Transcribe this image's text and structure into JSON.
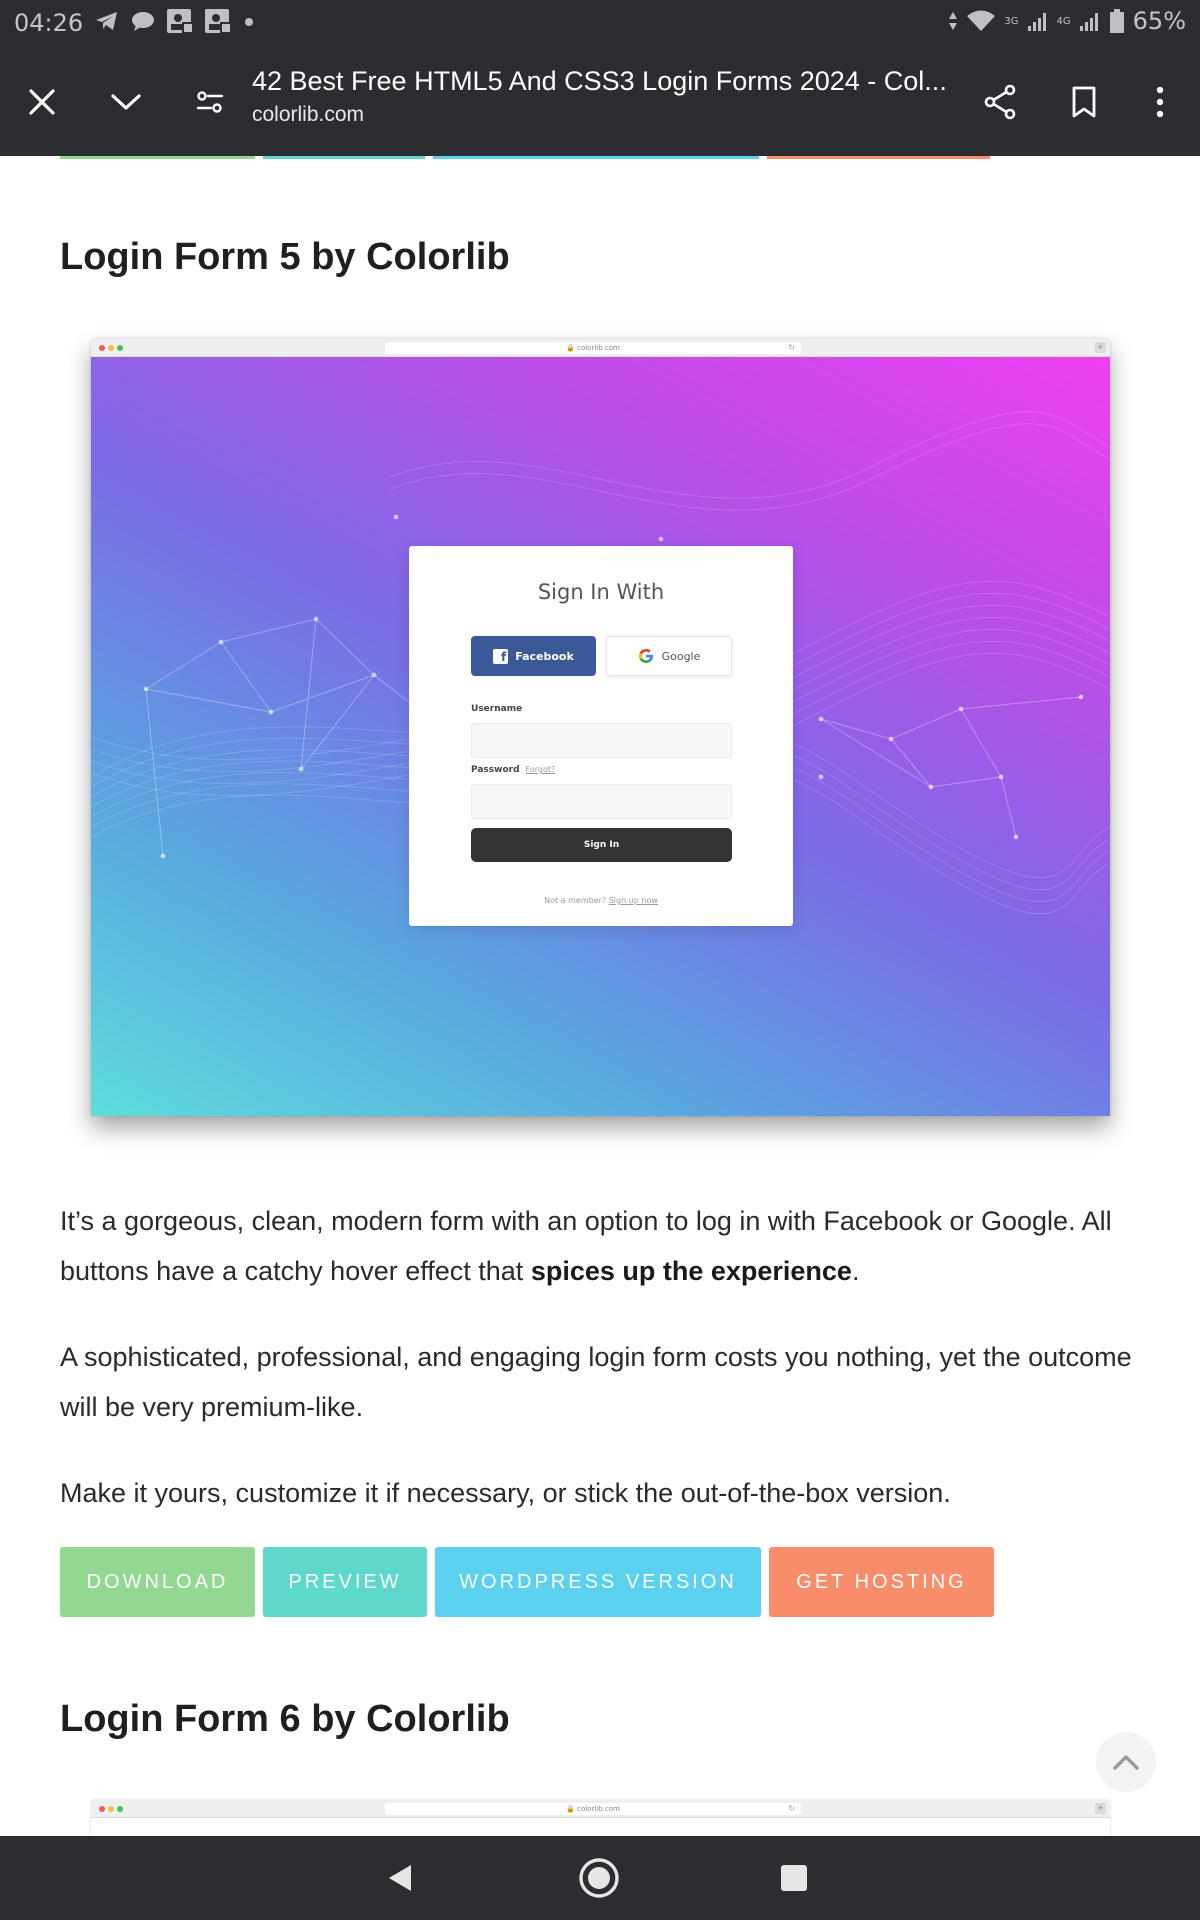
{
  "status_bar": {
    "time": "04:26",
    "left_icons": [
      "telegram-icon",
      "chat-bubble-icon",
      "photo-notification-icon",
      "photo-notification-icon",
      "dot-icon"
    ],
    "network_3g": "3G",
    "network_4g": "4G",
    "battery": "65%"
  },
  "toolbar": {
    "title": "42 Best Free HTML5 And CSS3 Login Forms 2024 - Col...",
    "url": "colorlib.com",
    "icons": [
      "close-icon",
      "chevron-down-icon",
      "page-settings-icon",
      "share-icon",
      "bookmark-icon",
      "more-vert-icon"
    ]
  },
  "article": {
    "section1_title": "Login Form 5 by Colorlib",
    "preview": {
      "address": "🔒 colorlib.com",
      "card_title": "Sign In With",
      "facebook_label": "Facebook",
      "google_label": "Google",
      "username_label": "Username",
      "password_label": "Password",
      "forgot_label": "Forgot?",
      "signin_label": "Sign In",
      "footer_text": "Not a member?",
      "footer_link": "Sign up now"
    },
    "para1_text": "It’s a gorgeous, clean, modern form with an option to log in with Facebook or Google. All buttons have a catchy hover effect that ",
    "para1_bold": "spices up the experience",
    "para1_end": ".",
    "para2": "A sophisticated, professional, and engaging login form costs you nothing, yet the outcome will be very premium-like.",
    "para3": "Make it yours, customize it if necessary, or stick the out-of-the-box version.",
    "buttons": [
      {
        "label": "DOWNLOAD",
        "color": "#93d891"
      },
      {
        "label": "PREVIEW",
        "color": "#5fd8cc"
      },
      {
        "label": "WORDPRESS VERSION",
        "color": "#5cd0ef"
      },
      {
        "label": "GET HOSTING",
        "color": "#f98c6b"
      }
    ],
    "section2_title": "Login Form 6 by Colorlib",
    "preview2_address": "🔒 colorlib.com"
  },
  "colors": {
    "chrome_bg": "#2c2d30",
    "facebook_blue": "#3b5998",
    "gradient": [
      "#5ddcdc",
      "#7a6ce6",
      "#ee3ff1"
    ]
  },
  "navbar": {
    "icons": [
      "back-icon",
      "home-icon",
      "recents-icon"
    ]
  }
}
